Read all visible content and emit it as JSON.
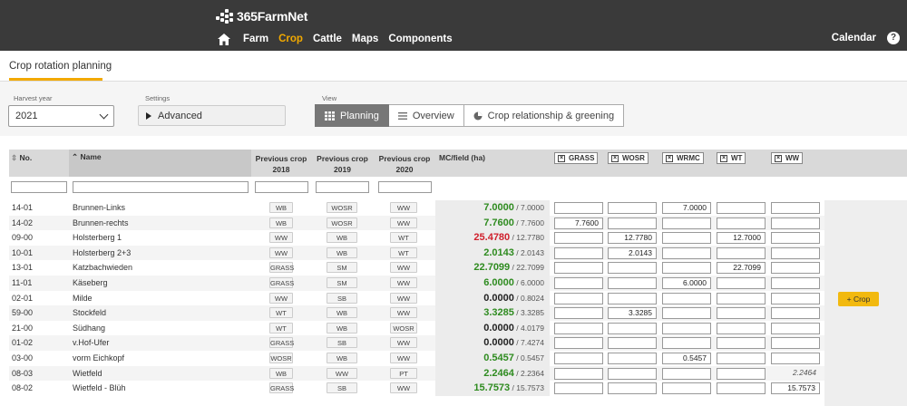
{
  "app": {
    "logo": "365FarmNet"
  },
  "nav": {
    "items": [
      "Farm",
      "Crop",
      "Cattle",
      "Maps",
      "Components"
    ],
    "active": "Crop",
    "calendar": "Calendar",
    "help": "?"
  },
  "page": {
    "title": "Crop rotation planning"
  },
  "filters": {
    "harvest_label": "Harvest year",
    "harvest_value": "2021",
    "settings_label": "Settings",
    "settings_value": "Advanced",
    "view_label": "View",
    "views": [
      "Planning",
      "Overview",
      "Crop relationship & greening"
    ],
    "active_view": "Planning"
  },
  "table": {
    "headers": {
      "no": "No.",
      "name": "Name",
      "prev2018": "Previous crop 2018",
      "prev2019": "Previous crop 2019",
      "prev2020": "Previous crop 2020",
      "mc": "MC/field (ha)"
    },
    "crop_columns": [
      "GRASS",
      "WOSR",
      "WRMC",
      "WT",
      "WW"
    ],
    "rows": [
      {
        "no": "14-01",
        "name": "Brunnen-Links",
        "p18": "WB",
        "p19": "WOSR",
        "p20": "WW",
        "mc": "7.0000",
        "mc_total": "/ 7.0000",
        "mc_color": "g",
        "alloc": [
          "",
          "",
          "7.0000",
          "",
          ""
        ]
      },
      {
        "no": "14-02",
        "name": "Brunnen-rechts",
        "p18": "WB",
        "p19": "WOSR",
        "p20": "WW",
        "mc": "7.7600",
        "mc_total": "/ 7.7600",
        "mc_color": "g",
        "alloc": [
          "7.7600",
          "",
          "",
          "",
          ""
        ]
      },
      {
        "no": "09-00",
        "name": "Holsterberg 1",
        "p18": "WW",
        "p19": "WB",
        "p20": "WT",
        "mc": "25.4780",
        "mc_total": "/ 12.7780",
        "mc_color": "r",
        "alloc": [
          "",
          "12.7780",
          "",
          "12.7000",
          ""
        ]
      },
      {
        "no": "10-01",
        "name": "Holsterberg 2+3",
        "p18": "WW",
        "p19": "WB",
        "p20": "WT",
        "mc": "2.0143",
        "mc_total": "/ 2.0143",
        "mc_color": "g",
        "alloc": [
          "",
          "2.0143",
          "",
          "",
          ""
        ]
      },
      {
        "no": "13-01",
        "name": "Katzbachwieden",
        "p18": "GRASS",
        "p19": "SM",
        "p20": "WW",
        "mc": "22.7099",
        "mc_total": "/ 22.7099",
        "mc_color": "g",
        "alloc": [
          "",
          "",
          "",
          "22.7099",
          ""
        ]
      },
      {
        "no": "11-01",
        "name": "Käseberg",
        "p18": "GRASS",
        "p19": "SM",
        "p20": "WW",
        "mc": "6.0000",
        "mc_total": "/ 6.0000",
        "mc_color": "g",
        "alloc": [
          "",
          "",
          "6.0000",
          "",
          ""
        ]
      },
      {
        "no": "02-01",
        "name": "Milde",
        "p18": "WW",
        "p19": "SB",
        "p20": "WW",
        "mc": "0.0000",
        "mc_total": "/ 0.8024",
        "mc_color": "k",
        "alloc": [
          "",
          "",
          "",
          "",
          ""
        ]
      },
      {
        "no": "59-00",
        "name": "Stockfeld",
        "p18": "WT",
        "p19": "WB",
        "p20": "WW",
        "mc": "3.3285",
        "mc_total": "/ 3.3285",
        "mc_color": "g",
        "alloc": [
          "",
          "3.3285",
          "",
          "",
          ""
        ]
      },
      {
        "no": "21-00",
        "name": "Südhang",
        "p18": "WT",
        "p19": "WB",
        "p20": "WOSR",
        "mc": "0.0000",
        "mc_total": "/ 4.0179",
        "mc_color": "k",
        "alloc": [
          "",
          "",
          "",
          "",
          ""
        ]
      },
      {
        "no": "01-02",
        "name": "v.Hof-Ufer",
        "p18": "GRASS",
        "p19": "SB",
        "p20": "WW",
        "mc": "0.0000",
        "mc_total": "/ 7.4274",
        "mc_color": "k",
        "alloc": [
          "",
          "",
          "",
          "",
          ""
        ]
      },
      {
        "no": "03-00",
        "name": "vorm Eichkopf",
        "p18": "WOSR",
        "p19": "WB",
        "p20": "WW",
        "mc": "0.5457",
        "mc_total": "/ 0.5457",
        "mc_color": "g",
        "alloc": [
          "",
          "",
          "0.5457",
          "",
          ""
        ]
      },
      {
        "no": "08-03",
        "name": "Wietfeld",
        "p18": "WB",
        "p19": "WW",
        "p20": "PT",
        "mc": "2.2464",
        "mc_total": "/ 2.2364",
        "mc_color": "g",
        "alloc": [
          "",
          "",
          "",
          "",
          ""
        ],
        "note": "2.2464"
      },
      {
        "no": "08-02",
        "name": "Wietfeld - Blüh",
        "p18": "GRASS",
        "p19": "SB",
        "p20": "WW",
        "mc": "15.7573",
        "mc_total": "/ 15.7573",
        "mc_color": "g",
        "alloc": [
          "",
          "",
          "",
          "",
          "15.7573"
        ]
      }
    ]
  },
  "crop_button": "+ Crop",
  "colors": {
    "accent": "#f2a900",
    "over": "#d0202c",
    "ok": "#2e8b1f",
    "topbar": "#3a3a3a"
  }
}
